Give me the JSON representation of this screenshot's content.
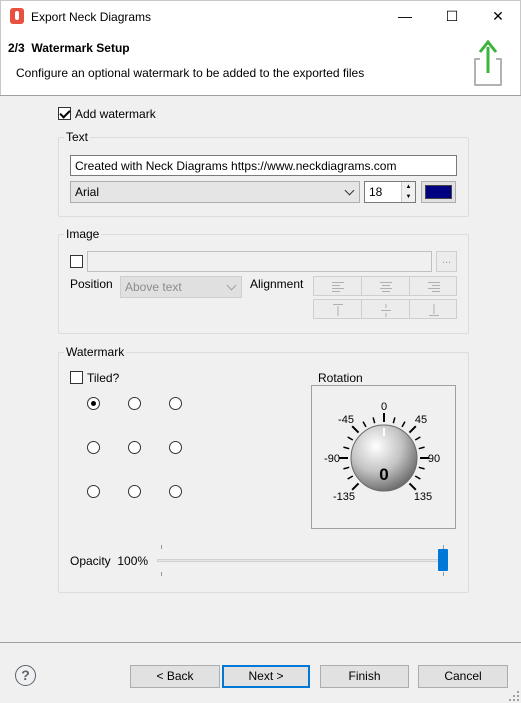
{
  "window": {
    "title": "Export Neck Diagrams",
    "minimize_glyph": "—",
    "maximize_glyph": "☐",
    "close_glyph": "✕"
  },
  "header": {
    "step": "2/3",
    "title": "Watermark Setup",
    "description": "Configure an optional watermark to be added to the exported files"
  },
  "add_watermark": {
    "label": "Add watermark",
    "checked": true
  },
  "text_group": {
    "label": "Text",
    "value": "Created with Neck Diagrams https://www.neckdiagrams.com",
    "font": "Arial",
    "size": "18",
    "color": "#000080"
  },
  "image_group": {
    "label": "Image",
    "browse_label": "...",
    "position_label": "Position",
    "position_value": "Above text",
    "alignment_label": "Alignment"
  },
  "watermark_group": {
    "label": "Watermark",
    "tiled_label": "Tiled?",
    "rotation_label": "Rotation",
    "rotation_value": "0",
    "dial_labels": {
      "top": "0",
      "tr": "45",
      "right": "90",
      "br": "135",
      "bl": "-135",
      "left": "-90",
      "tl": "-45"
    },
    "opacity_label": "Opacity",
    "opacity_value": "100%",
    "opacity_fraction": 1.0
  },
  "footer": {
    "help_glyph": "?",
    "back_label": "< Back",
    "next_label": "Next >",
    "finish_label": "Finish",
    "cancel_label": "Cancel"
  },
  "colors": {
    "accent": "#0078d7",
    "export_icon": "#3cb43c"
  }
}
